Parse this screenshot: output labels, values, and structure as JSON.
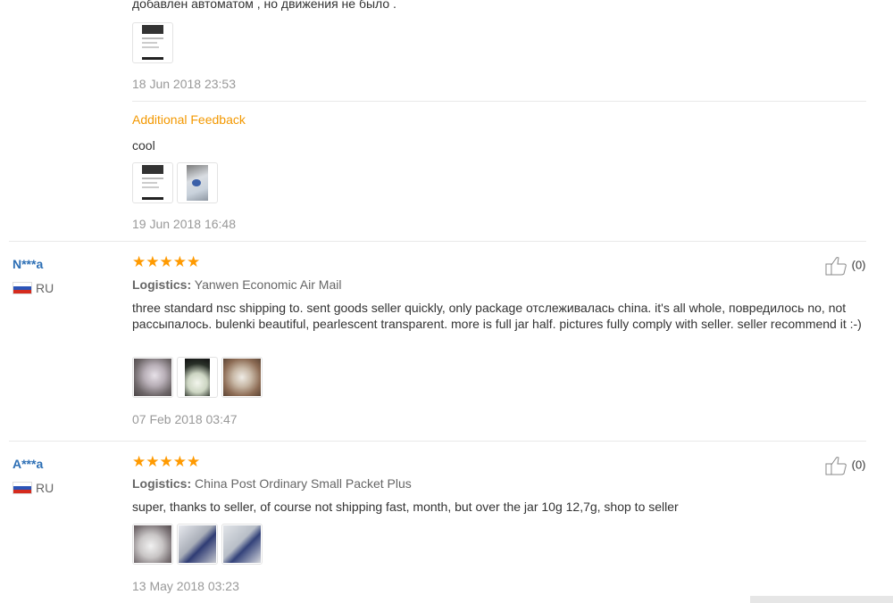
{
  "review0": {
    "text_tail": "добавлен автоматом , но движения не было .",
    "date": "18 Jun 2018 23:53",
    "additional": {
      "heading": "Additional Feedback",
      "text": "cool",
      "date": "19 Jun 2018 16:48"
    }
  },
  "review1": {
    "user": "N***a",
    "country": "RU",
    "helpful_count": "(0)",
    "logistics_label": "Logistics:",
    "logistics_value": "Yanwen Economic Air Mail",
    "text": "three standard nsc shipping to. sent goods seller quickly, only package отслеживалась china. it's all whole, повредилось no, not рассыпалось. bulenki beautiful, pearlescent transparent. more is full jar half. pictures fully comply with seller. seller recommend it :-)",
    "date": "07 Feb 2018 03:47",
    "rating": 5
  },
  "review2": {
    "user": "A***a",
    "country": "RU",
    "helpful_count": "(0)",
    "logistics_label": "Logistics:",
    "logistics_value": "China Post Ordinary Small Packet Plus",
    "text": "super, thanks to seller, of course not shipping fast, month, but over the jar 10g 12,7g, shop to seller",
    "date": "13 May 2018 03:23",
    "rating": 5
  },
  "colors": {
    "accent": "#ff9a00",
    "username": "#2d6fb5",
    "additional": "#f39800"
  }
}
